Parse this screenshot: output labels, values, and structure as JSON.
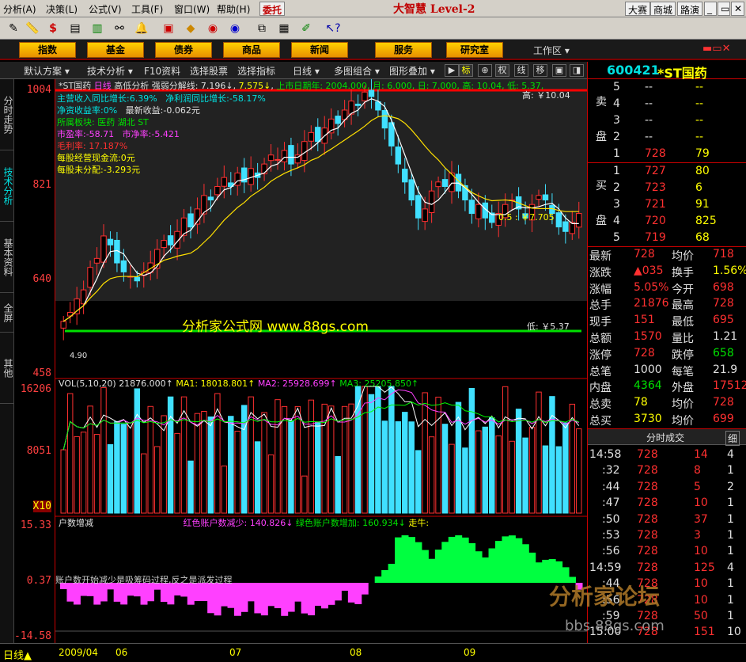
{
  "menu": {
    "items": [
      "分析(A)",
      "决策(L)",
      "公式(V)",
      "工具(F)",
      "窗口(W)",
      "帮助(H)"
    ],
    "entrust": "委托",
    "brand": "大智慧 Level-2",
    "btn_dasai": "大赛",
    "btn_mall": "商城",
    "btn_road": "路演",
    "win_min": "_",
    "win_max": "▭",
    "win_close": "✕"
  },
  "nav": {
    "items": [
      "指数",
      "基金",
      "债券",
      "商品",
      "新闻",
      "服务",
      "研究室"
    ],
    "workspace": "工作区 ▾"
  },
  "subbar": {
    "items": [
      "默认方案 ▾",
      "技术分析 ▾",
      "F10资料",
      "选择股票",
      "选择指标",
      "日线 ▾",
      "多图组合 ▾",
      "图形叠加 ▾"
    ],
    "keys": [
      "▶",
      "标",
      "⊕",
      "权",
      "线",
      "移",
      "▣",
      "◨"
    ]
  },
  "lefttabs": [
    "分时走势",
    "技术分析",
    "基本资料",
    "全屏",
    "其他"
  ],
  "axis": {
    "main": [
      "1004",
      "821",
      "640",
      "458"
    ],
    "vol": [
      "16206",
      "8051",
      "X10"
    ],
    "ind": [
      "15.33",
      "0.37",
      "-14.58"
    ]
  },
  "header": {
    "stock": "*ST国药",
    "period": "日线",
    "mode": "高低分析",
    "ma_title": "强弱分解线:",
    "ma1": "7.196↓",
    "ma2": "7.575↓",
    "listed": "上市日期年: 2004.000, 月: 6.000, 日: 7.000, 高: 10.04, 低: 5.37,"
  },
  "info": {
    "l1a": "主营收入同比增长:6.39%",
    "l1b": "净利润同比增长:-58.17%",
    "l2a": "净资收益率:0%",
    "l2b": "最新收益:-0.062元",
    "l3": "所属板块: 医药 湖北 ST",
    "l4a": "市盈率:-58.71",
    "l4b": "市净率:-5.421",
    "l5": "毛利率: 17.187%",
    "l6": "每股经营现金流:0元",
    "l7": "每股未分配:-3.293元"
  },
  "chartlabels": {
    "high": "高: ￥10.04",
    "low": "低: ￥5.37",
    "watermark": "分析家公式网 www.88gs.com",
    "minval": "4.90",
    "pct": "0.5 : ￥7.705"
  },
  "vol": {
    "label": "VOL(5,10,20)",
    "val": "21876.000↑",
    "ma1": "MA1: 18018.801↑",
    "ma2": "MA2: 25928.699↑",
    "ma3": "MA3: 25205.850↑"
  },
  "ind": {
    "title": "户数增减",
    "red": "红色账户数减少: 140.826↓",
    "green": "绿色账户数增加: 160.934↓",
    "trend": "走牛:",
    "note": "账户数开始减少是吸筹码过程,反之是派发过程"
  },
  "right": {
    "code": "600421",
    "name": "*ST国药",
    "sell": [
      {
        "n": "5",
        "p": "--",
        "v": "--"
      },
      {
        "n": "4",
        "p": "--",
        "v": "--"
      },
      {
        "n": "3",
        "p": "--",
        "v": "--"
      },
      {
        "n": "2",
        "p": "--",
        "v": "--"
      },
      {
        "n": "1",
        "p": "728",
        "v": "79"
      }
    ],
    "buy": [
      {
        "n": "1",
        "p": "727",
        "v": "80"
      },
      {
        "n": "2",
        "p": "723",
        "v": "6"
      },
      {
        "n": "3",
        "p": "721",
        "v": "91"
      },
      {
        "n": "4",
        "p": "720",
        "v": "825"
      },
      {
        "n": "5",
        "p": "719",
        "v": "68"
      }
    ],
    "sell_label": [
      "卖",
      "盘"
    ],
    "buy_label": [
      "买",
      "盘"
    ],
    "stats": [
      [
        "最新",
        "728",
        "均价",
        "718"
      ],
      [
        "涨跌",
        "▲035",
        "换手",
        "1.56%"
      ],
      [
        "涨幅",
        "5.05%",
        "今开",
        "698"
      ],
      [
        "总手",
        "21876",
        "最高",
        "728"
      ],
      [
        "现手",
        "151",
        "最低",
        "695"
      ],
      [
        "总额",
        "1570",
        "量比",
        "1.21"
      ],
      [
        "涨停",
        "728",
        "跌停",
        "658"
      ],
      [
        "总笔",
        "1000",
        "每笔",
        "21.9"
      ],
      [
        "内盘",
        "4364",
        "外盘",
        "17512"
      ],
      [
        "总卖",
        "78",
        "均价",
        "728"
      ],
      [
        "总买",
        "3730",
        "均价",
        "699"
      ]
    ],
    "ticks_title": "分时成交",
    "ticks_btn": "细",
    "ticks": [
      [
        "14:58",
        "728",
        "14",
        "4"
      ],
      [
        ":32",
        "728",
        "8",
        "1"
      ],
      [
        ":44",
        "728",
        "5",
        "2"
      ],
      [
        ":47",
        "728",
        "10",
        "1"
      ],
      [
        ":50",
        "728",
        "37",
        "1"
      ],
      [
        ":53",
        "728",
        "3",
        "1"
      ],
      [
        ":56",
        "728",
        "10",
        "1"
      ],
      [
        "14:59",
        "728",
        "125",
        "4"
      ],
      [
        ":44",
        "728",
        "10",
        "1"
      ],
      [
        ":56",
        "728",
        "10",
        "1"
      ],
      [
        ":59",
        "728",
        "50",
        "1"
      ],
      [
        "15:00",
        "728",
        "151",
        "10"
      ]
    ]
  },
  "forum": {
    "title": "分析家论坛",
    "url": "bbs.88gs.com"
  },
  "bottom": {
    "period": "日线▲",
    "dates": [
      "2009/04",
      "06",
      "07",
      "08",
      "09"
    ]
  },
  "chart_data": {
    "type": "candlestick",
    "title": "",
    "high": 10.04,
    "low": 5.37,
    "ylim": [
      4.58,
      10.04
    ],
    "closes": [
      4.9,
      5.1,
      5.4,
      5.6,
      6.1,
      6.3,
      6.8,
      6.6,
      6.2,
      6.0,
      5.9,
      5.8,
      6.0,
      6.2,
      6.5,
      6.7,
      6.6,
      6.9,
      7.2,
      7.0,
      7.4,
      7.7,
      7.6,
      7.9,
      8.1,
      7.9,
      8.2,
      8.0,
      8.3,
      8.1,
      8.4,
      8.6,
      8.5,
      8.7,
      8.4,
      8.6,
      8.9,
      9.1,
      8.9,
      9.2,
      9.4,
      9.3,
      9.6,
      9.8,
      9.7,
      10.0,
      9.9,
      9.6,
      9.2,
      8.8,
      8.4,
      8.0,
      7.6,
      7.2,
      7.4,
      7.8,
      8.0,
      7.9,
      8.2,
      7.8,
      7.6,
      7.3,
      7.5,
      7.2,
      7.1,
      7.3,
      7.5,
      7.6,
      7.4,
      7.2,
      7.5,
      7.7,
      7.6,
      7.3,
      7.0,
      6.9,
      7.1,
      7.3
    ]
  }
}
